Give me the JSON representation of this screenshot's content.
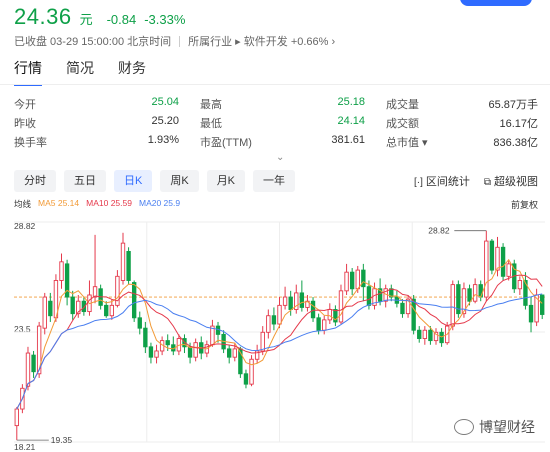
{
  "quote": {
    "price": "24.36",
    "unit": "元",
    "change": "-0.84",
    "change_pct": "-3.33%"
  },
  "status": {
    "closed": "已收盘 03-29 15:00:00 北京时间",
    "industry": "所属行业 ▸ 软件开发 +0.66% ›"
  },
  "tabs": [
    "行情",
    "简况",
    "财务"
  ],
  "stats": [
    [
      {
        "label": "今开",
        "value": "25.04",
        "color": "g"
      },
      {
        "label": "最高",
        "value": "25.18",
        "color": "g"
      },
      {
        "label": "成交量",
        "value": "65.87万手",
        "color": ""
      }
    ],
    [
      {
        "label": "昨收",
        "value": "25.20",
        "color": ""
      },
      {
        "label": "最低",
        "value": "24.14",
        "color": "g"
      },
      {
        "label": "成交额",
        "value": "16.17亿",
        "color": ""
      }
    ],
    [
      {
        "label": "换手率",
        "value": "1.93%",
        "color": ""
      },
      {
        "label": "市盈(TTM)",
        "value": "381.61",
        "color": ""
      },
      {
        "label": "总市值 ▾",
        "value": "836.38亿",
        "color": ""
      }
    ]
  ],
  "periods": [
    "分时",
    "五日",
    "日K",
    "周K",
    "月K",
    "一年"
  ],
  "active_period": "日K",
  "tools": {
    "range": "区间统计",
    "super": "超级视图"
  },
  "legend": {
    "title": "均线",
    "ma5": "MA5 25.14",
    "ma10": "MA10 25.59",
    "ma20": "MA20 25.9"
  },
  "adjust": "前复权",
  "axis": {
    "high": "28.82",
    "mid": "23.5",
    "low": "18.21",
    "max_marker": "28.82",
    "min_marker": "19.35"
  },
  "colors": {
    "up": "#e5394b",
    "down": "#0ea048",
    "ma5": "#f29b38",
    "ma10": "#e5394b",
    "ma20": "#4a7ff0"
  },
  "watermark": "博望财经",
  "chart_data": {
    "type": "candlestick",
    "ylim": [
      18.21,
      28.82
    ],
    "candles": [
      [
        19.0,
        19.8,
        18.3,
        19.9
      ],
      [
        19.8,
        20.8,
        19.6,
        21.0
      ],
      [
        20.9,
        22.5,
        20.7,
        22.8
      ],
      [
        22.4,
        21.6,
        21.3,
        22.6
      ],
      [
        21.5,
        23.8,
        21.3,
        24.0
      ],
      [
        23.7,
        25.2,
        23.4,
        25.4
      ],
      [
        25.0,
        24.3,
        24.0,
        25.4
      ],
      [
        24.2,
        26.0,
        24.0,
        26.3
      ],
      [
        26.0,
        26.9,
        25.6,
        27.3
      ],
      [
        26.8,
        25.2,
        24.8,
        27.0
      ],
      [
        25.2,
        24.4,
        24.1,
        25.5
      ],
      [
        24.4,
        25.0,
        24.2,
        25.3
      ],
      [
        25.0,
        24.5,
        24.3,
        25.2
      ],
      [
        24.5,
        25.3,
        24.3,
        26.0
      ],
      [
        25.2,
        25.7,
        24.9,
        28.2
      ],
      [
        25.6,
        24.8,
        24.6,
        25.8
      ],
      [
        24.8,
        24.3,
        24.2,
        25.0
      ],
      [
        24.3,
        24.8,
        24.1,
        25.1
      ],
      [
        24.8,
        26.2,
        24.7,
        26.5
      ],
      [
        26.0,
        27.8,
        25.8,
        28.3
      ],
      [
        27.4,
        26.0,
        25.8,
        27.6
      ],
      [
        25.9,
        24.2,
        24.0,
        26.0
      ],
      [
        24.2,
        23.7,
        23.4,
        24.5
      ],
      [
        23.7,
        22.8,
        22.5,
        24.0
      ],
      [
        22.8,
        22.3,
        22.0,
        23.0
      ],
      [
        22.3,
        22.6,
        22.0,
        22.9
      ],
      [
        22.6,
        23.1,
        22.4,
        23.3
      ],
      [
        23.1,
        22.9,
        22.6,
        23.4
      ],
      [
        22.9,
        22.6,
        22.4,
        23.3
      ],
      [
        22.6,
        23.2,
        22.4,
        23.4
      ],
      [
        23.2,
        22.8,
        22.5,
        23.4
      ],
      [
        22.8,
        22.3,
        22.0,
        23.0
      ],
      [
        22.3,
        23.0,
        22.1,
        23.2
      ],
      [
        23.0,
        22.5,
        22.2,
        23.3
      ],
      [
        22.5,
        22.9,
        22.3,
        23.1
      ],
      [
        22.9,
        23.8,
        22.8,
        24.1
      ],
      [
        23.8,
        23.4,
        23.0,
        24.0
      ],
      [
        23.4,
        22.7,
        22.5,
        23.6
      ],
      [
        22.7,
        22.3,
        22.0,
        22.9
      ],
      [
        22.3,
        22.7,
        22.1,
        23.0
      ],
      [
        22.7,
        21.5,
        21.3,
        22.8
      ],
      [
        21.5,
        21.0,
        20.8,
        21.7
      ],
      [
        21.0,
        22.2,
        20.9,
        22.4
      ],
      [
        22.2,
        22.6,
        22.0,
        22.9
      ],
      [
        22.6,
        23.5,
        22.4,
        23.8
      ],
      [
        23.5,
        24.3,
        23.2,
        24.6
      ],
      [
        24.3,
        23.9,
        23.6,
        24.7
      ],
      [
        23.9,
        24.8,
        23.7,
        25.2
      ],
      [
        24.8,
        25.2,
        24.6,
        25.7
      ],
      [
        25.2,
        24.6,
        24.3,
        25.5
      ],
      [
        24.6,
        25.4,
        24.4,
        25.8
      ],
      [
        25.4,
        24.7,
        24.5,
        26.0
      ],
      [
        24.7,
        25.0,
        24.5,
        25.3
      ],
      [
        25.0,
        24.2,
        24.0,
        25.2
      ],
      [
        24.2,
        23.6,
        23.4,
        24.4
      ],
      [
        23.6,
        24.1,
        23.4,
        24.3
      ],
      [
        24.1,
        24.6,
        23.9,
        24.9
      ],
      [
        24.6,
        24.0,
        23.8,
        24.8
      ],
      [
        24.0,
        25.5,
        23.9,
        25.8
      ],
      [
        25.5,
        26.4,
        25.3,
        26.8
      ],
      [
        26.4,
        25.6,
        25.3,
        26.6
      ],
      [
        25.6,
        26.5,
        25.4,
        26.7
      ],
      [
        26.5,
        25.7,
        25.0,
        26.8
      ],
      [
        25.7,
        24.8,
        24.6,
        26.0
      ],
      [
        24.8,
        25.6,
        24.6,
        25.9
      ],
      [
        25.6,
        25.0,
        24.8,
        26.1
      ],
      [
        25.0,
        25.6,
        24.7,
        25.8
      ],
      [
        25.6,
        25.2,
        25.0,
        25.8
      ],
      [
        25.2,
        24.9,
        24.7,
        25.5
      ],
      [
        24.9,
        24.4,
        24.2,
        25.1
      ],
      [
        24.4,
        25.1,
        24.2,
        25.3
      ],
      [
        25.1,
        23.6,
        23.4,
        25.3
      ],
      [
        23.6,
        23.2,
        23.0,
        23.8
      ],
      [
        23.2,
        23.6,
        22.9,
        23.8
      ],
      [
        23.6,
        23.1,
        22.9,
        23.8
      ],
      [
        23.1,
        23.5,
        22.9,
        23.7
      ],
      [
        23.5,
        23.0,
        22.8,
        23.7
      ],
      [
        23.0,
        23.8,
        22.9,
        24.0
      ],
      [
        23.8,
        25.8,
        23.6,
        26.0
      ],
      [
        25.8,
        24.4,
        24.2,
        26.0
      ],
      [
        24.4,
        25.6,
        24.2,
        25.9
      ],
      [
        25.6,
        25.0,
        24.8,
        25.8
      ],
      [
        25.0,
        25.8,
        24.9,
        26.1
      ],
      [
        25.8,
        25.2,
        25.0,
        26.0
      ],
      [
        25.2,
        27.9,
        25.0,
        28.4
      ],
      [
        27.9,
        26.5,
        26.3,
        28.0
      ],
      [
        26.5,
        27.6,
        26.2,
        28.1
      ],
      [
        27.6,
        26.2,
        26.0,
        27.8
      ],
      [
        26.2,
        26.8,
        26.0,
        27.0
      ],
      [
        26.8,
        25.6,
        25.4,
        27.0
      ],
      [
        25.6,
        26.0,
        25.3,
        26.2
      ],
      [
        26.0,
        24.8,
        24.6,
        26.4
      ],
      [
        24.8,
        24.0,
        23.5,
        25.2
      ],
      [
        24.0,
        25.3,
        23.8,
        25.6
      ],
      [
        25.3,
        24.36,
        24.14,
        25.18
      ]
    ]
  }
}
